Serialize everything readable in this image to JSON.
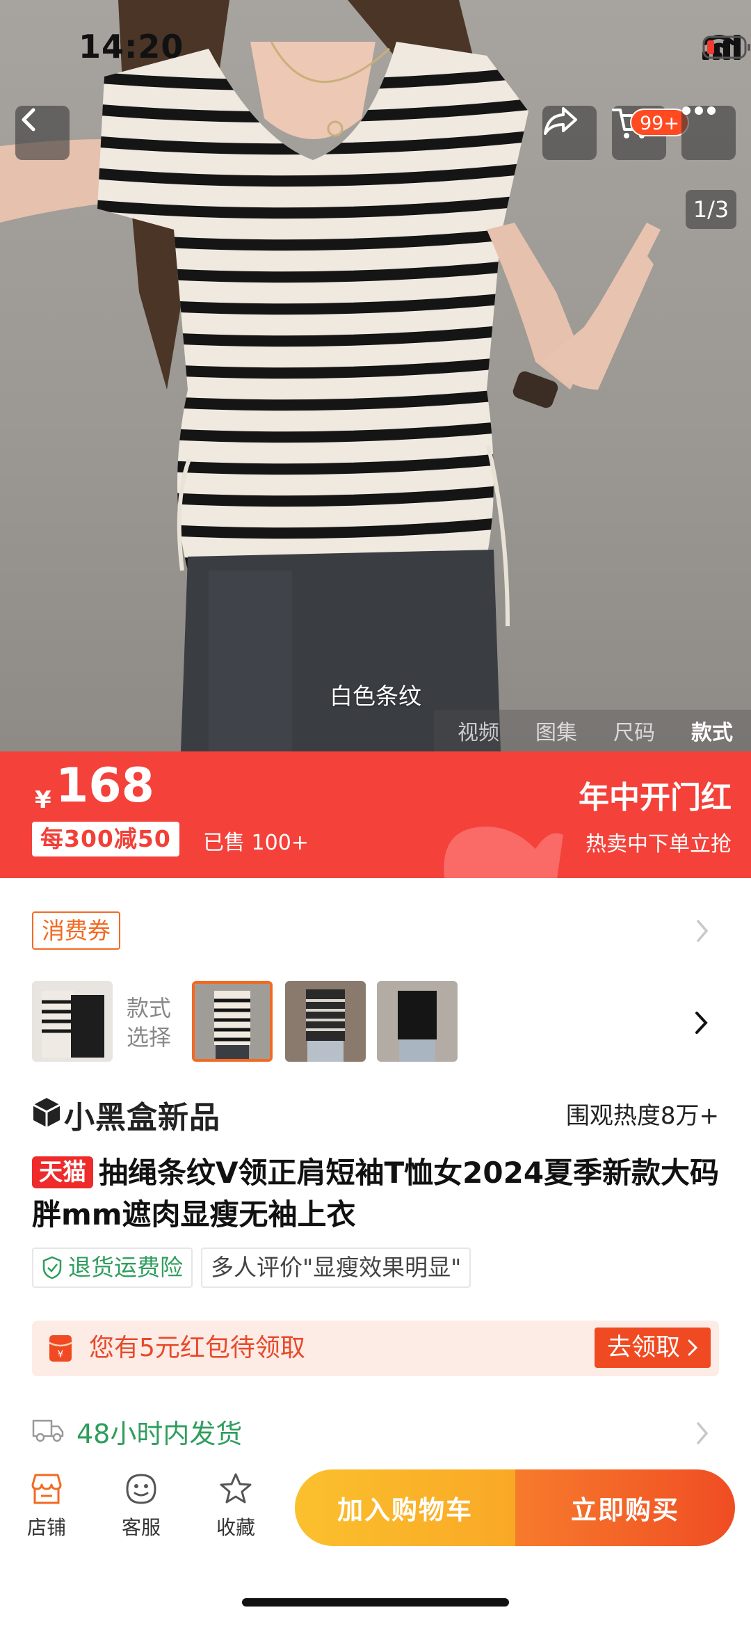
{
  "status_bar": {
    "time": "14:20"
  },
  "hero": {
    "cart_badge": "99+",
    "image_counter": "1/3",
    "caption": "白色条纹",
    "media_tabs": [
      "视频",
      "图集",
      "尺码",
      "款式"
    ],
    "active_tab": "款式"
  },
  "price_banner": {
    "currency": "¥",
    "price": "168",
    "promo": "每300减50",
    "sold": "已售 100+",
    "event_title": "年中开门红",
    "event_sub": "热卖中下单立抢"
  },
  "coupon": {
    "label": "消费券"
  },
  "styles": {
    "label_line1": "款式",
    "label_line2": "选择"
  },
  "brand": {
    "name": "小黑盒新品",
    "heat": "围观热度8万+"
  },
  "product": {
    "tag": "天猫",
    "title": "抽绳条纹V领正肩短袖T恤女2024夏季新款大码胖mm遮肉显瘦无袖上衣"
  },
  "badges": {
    "insurance": "退货运费险",
    "review": "多人评价\"显瘦效果明显\""
  },
  "red_packet": {
    "text": "您有5元红包待领取",
    "button": "去领取"
  },
  "shipping": {
    "text": "48小时内发货"
  },
  "bottom_bar": {
    "store": "店铺",
    "service": "客服",
    "favorite": "收藏",
    "add_to_cart": "加入购物车",
    "buy_now": "立即购买"
  },
  "colors": {
    "brand_red": "#f4413a",
    "orange": "#f26a22",
    "green": "#2f9d5d",
    "yellow": "#fbc02d"
  }
}
